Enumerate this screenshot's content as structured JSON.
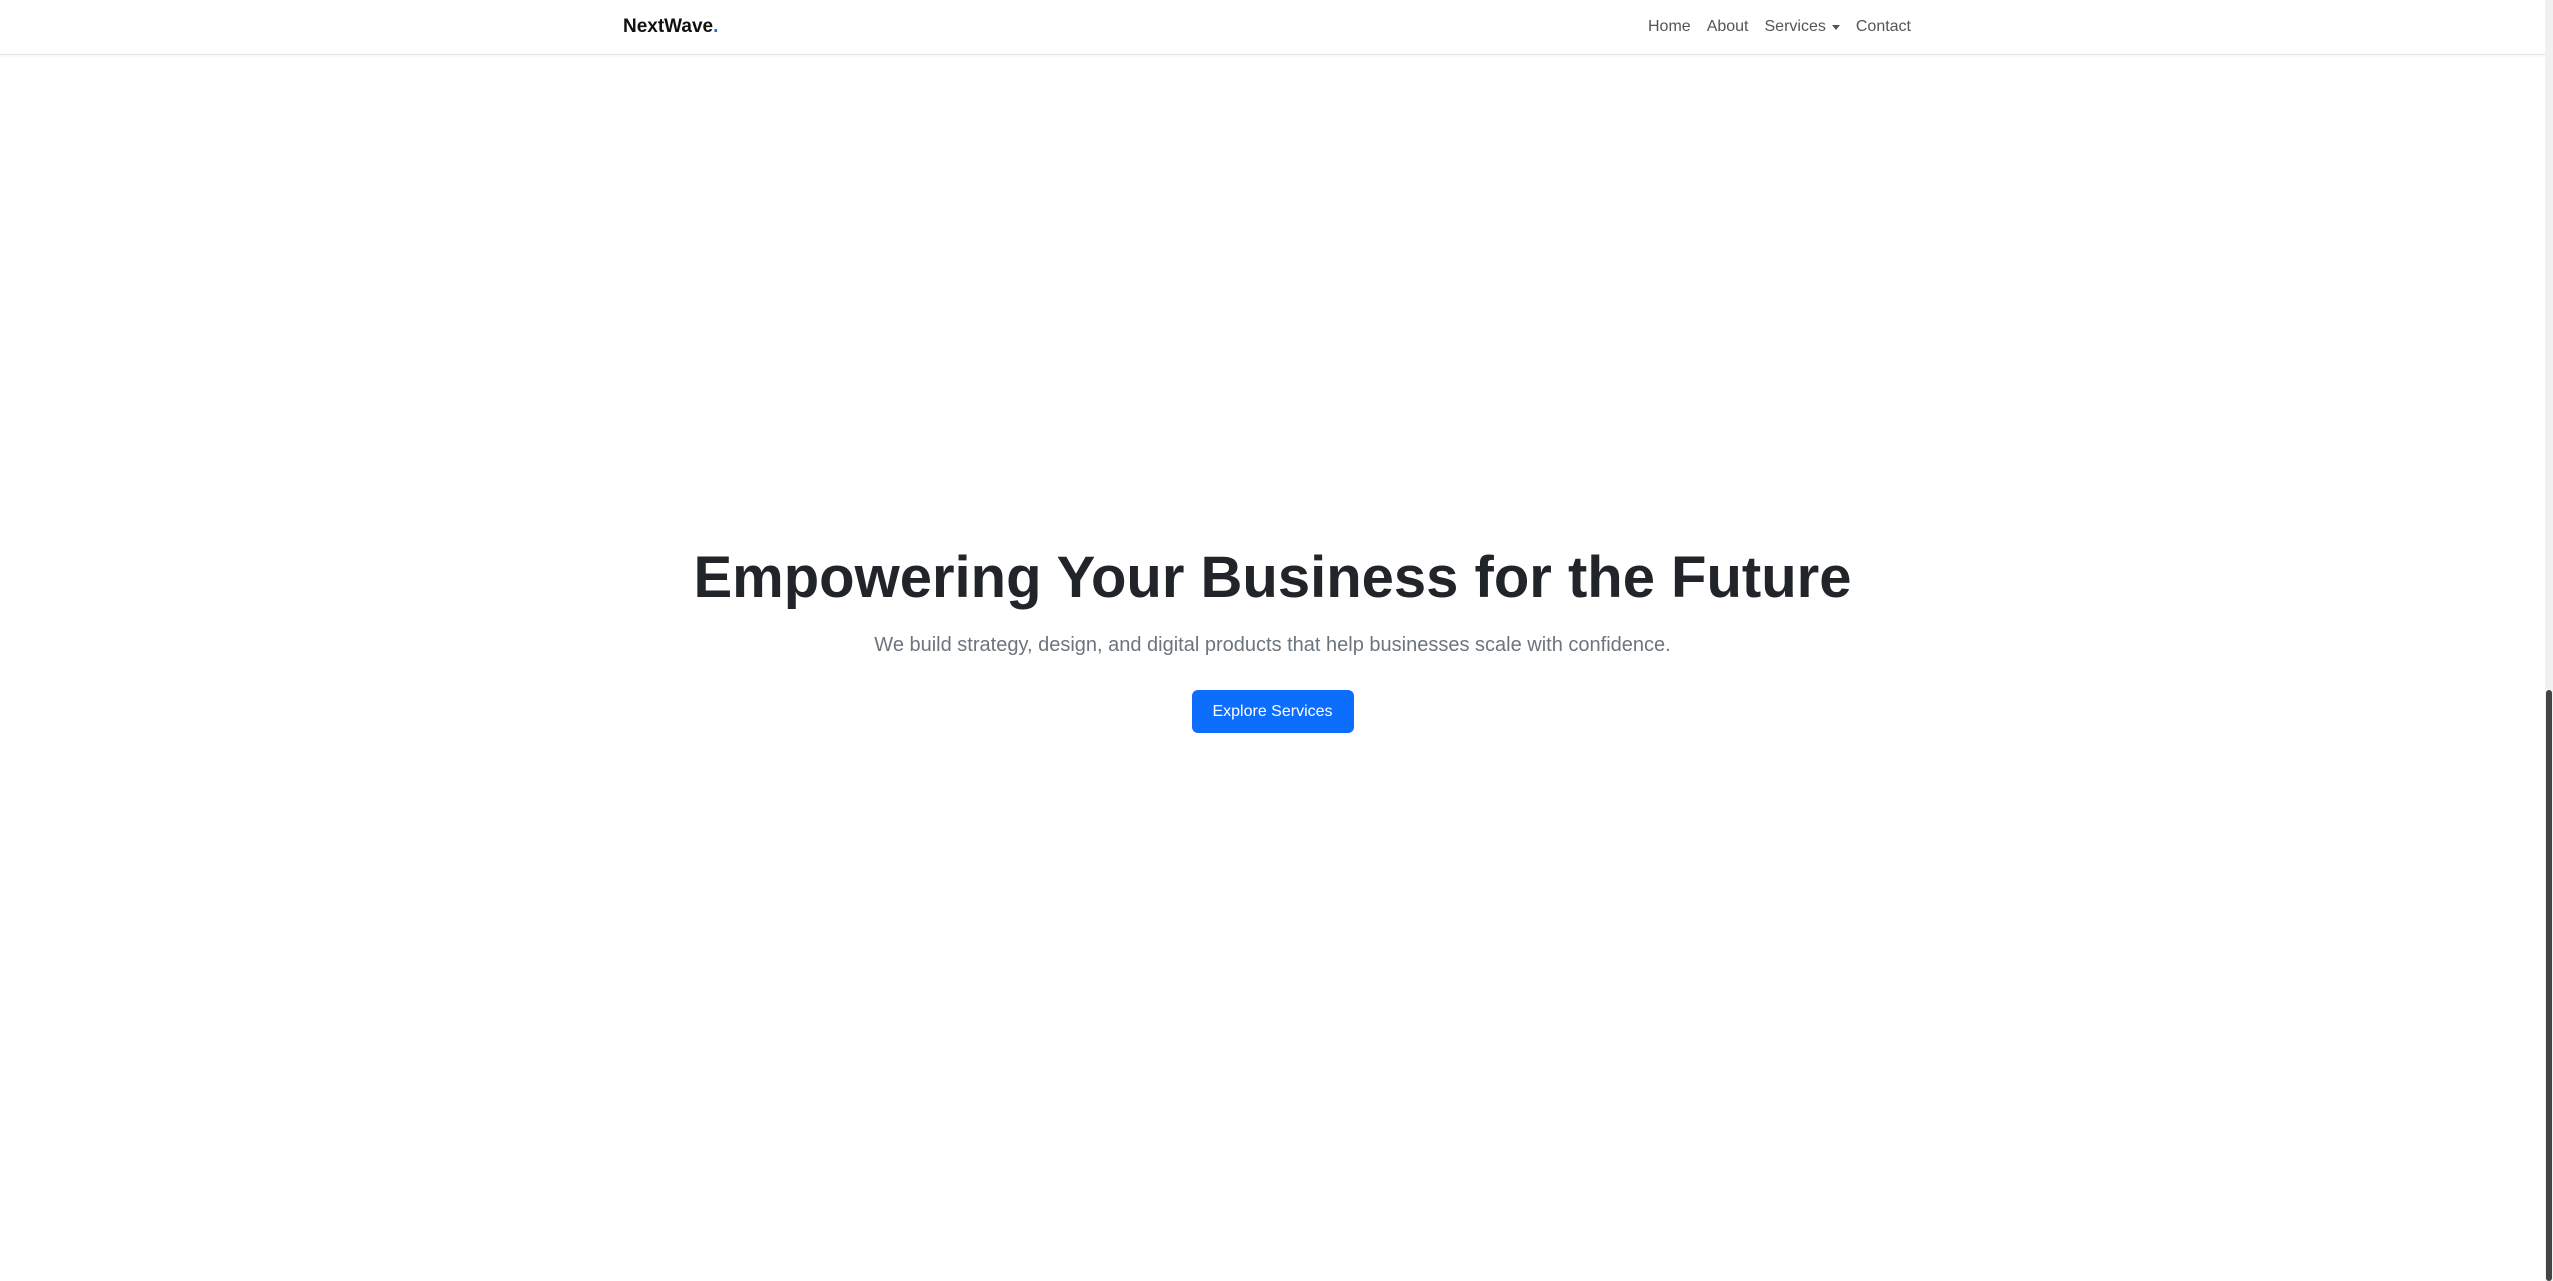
{
  "navbar": {
    "brand": "NextWave",
    "brand_dot": ".",
    "links": {
      "home": "Home",
      "about": "About",
      "services": "Services",
      "contact": "Contact"
    }
  },
  "hero": {
    "title": "Empowering Your Business for the Future",
    "subtitle": "We build strategy, design, and digital products that help businesses scale with confidence.",
    "cta_label": "Explore Services"
  },
  "colors": {
    "accent": "#0d6efd",
    "heading": "#212529",
    "muted": "#6c757d"
  },
  "icons": {
    "services_dropdown": "caret-down-icon"
  }
}
